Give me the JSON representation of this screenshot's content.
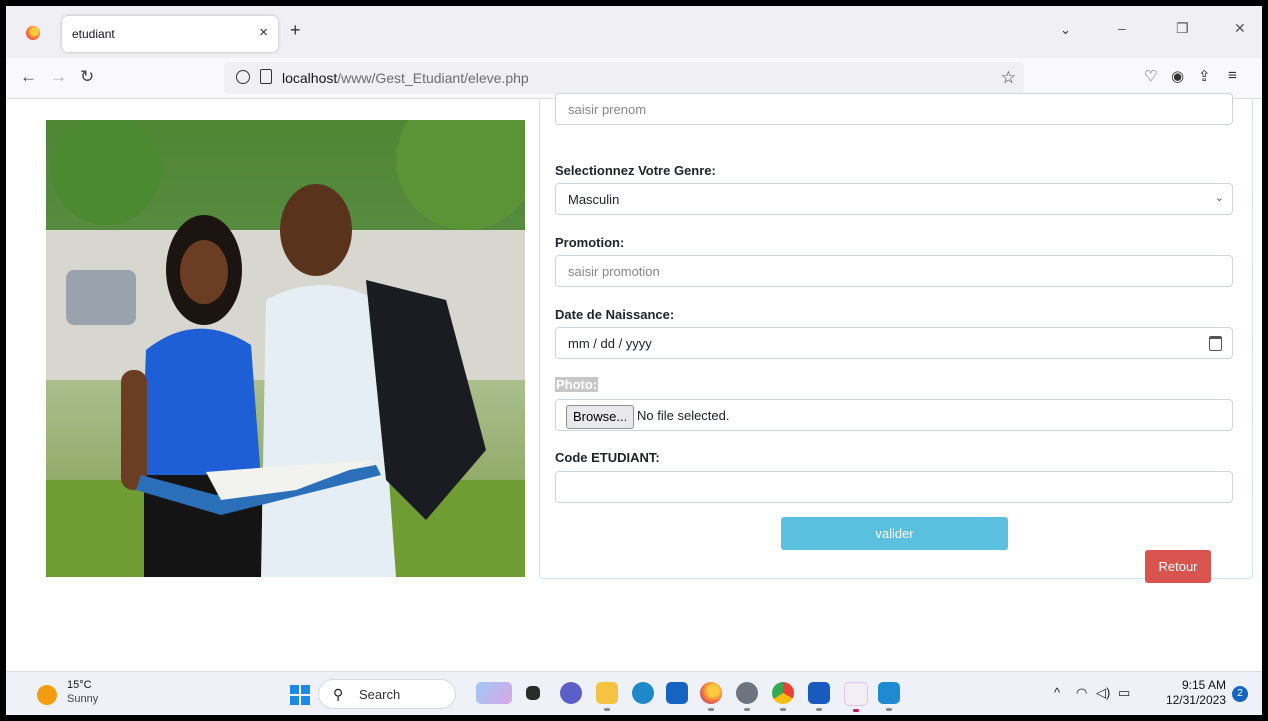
{
  "browser": {
    "tab_title": "etudiant",
    "tab_close": "×",
    "new_tab": "+",
    "tabs_list": "⌄",
    "url_host": "localhost",
    "url_path": "/www/Gest_Etudiant/eleve.php",
    "minimize": "–",
    "restore": "❐",
    "close": "✕"
  },
  "form": {
    "prenom_placeholder": "saisir prenom",
    "genre_label": "Selectionnez Votre Genre:",
    "genre_value": "Masculin",
    "promotion_label": "Promotion:",
    "promotion_placeholder": "saisir promotion",
    "naissance_label": "Date de Naissance:",
    "naissance_placeholder": "mm / dd / yyyy",
    "photo_label": "Photo:",
    "browse_label": "Browse...",
    "no_file": "No file selected.",
    "code_label": "Code ETUDIANT:",
    "code_value": "",
    "valider_label": "valider",
    "retour_label": "Retour"
  },
  "taskbar": {
    "temperature": "15°C",
    "weather": "Sunny",
    "search_label": "Search",
    "time": "9:15 AM",
    "date": "12/31/2023",
    "notifications": "2"
  },
  "colors": {
    "valider": "#5bc0de",
    "retour": "#d9534f"
  }
}
